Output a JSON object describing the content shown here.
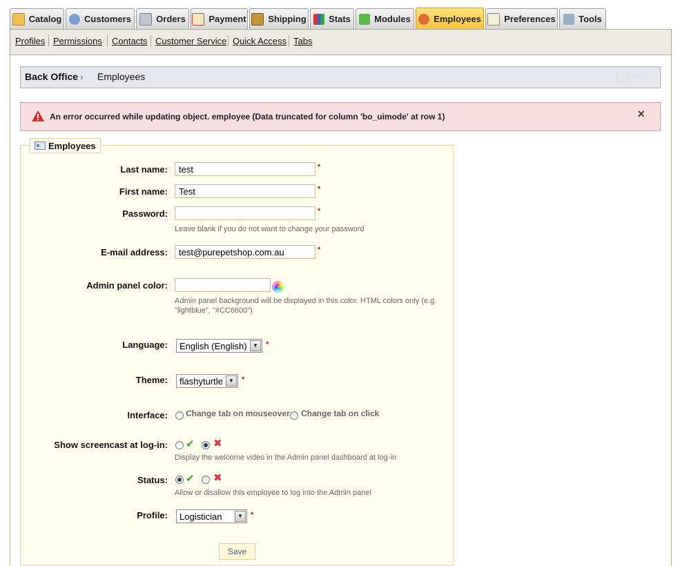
{
  "tabs": [
    {
      "label": "Catalog",
      "icon": "folder-icon",
      "active": false
    },
    {
      "label": "Customers",
      "icon": "user-icon",
      "active": false
    },
    {
      "label": "Orders",
      "icon": "cart-icon",
      "active": false
    },
    {
      "label": "Payment",
      "icon": "invoice-icon",
      "active": false
    },
    {
      "label": "Shipping",
      "icon": "truck-icon",
      "active": false
    },
    {
      "label": "Stats",
      "icon": "bar-chart-icon",
      "active": false
    },
    {
      "label": "Modules",
      "icon": "puzzle-icon",
      "active": false
    },
    {
      "label": "Employees",
      "icon": "employee-icon",
      "active": true
    },
    {
      "label": "Preferences",
      "icon": "preferences-icon",
      "active": false
    },
    {
      "label": "Tools",
      "icon": "wrench-icon",
      "active": false
    }
  ],
  "submenu": [
    "Profiles",
    "Permissions",
    "Contacts",
    "Customer Service",
    "Quick Access",
    "Tabs"
  ],
  "breadcrumb": {
    "root": "Back Office",
    "separator": "›",
    "current": "Employees",
    "help": "HELP"
  },
  "error": {
    "message": "An error occurred while updating object. employee (Data truncated for column 'bo_uimode' at row 1)",
    "close": "×"
  },
  "form": {
    "legend": "Employees",
    "last_name": {
      "label": "Last name:",
      "value": "test"
    },
    "first_name": {
      "label": "First name:",
      "value": "Test"
    },
    "password": {
      "label": "Password:",
      "value": "",
      "hint": "Leave blank if you do not want to change your password"
    },
    "email": {
      "label": "E-mail address:",
      "value": "test@purepetshop.com.au"
    },
    "admin_color": {
      "label": "Admin panel color:",
      "value": "",
      "hint_line1": "Admin panel background will be displayed in this color. HTML colors only (e.g.",
      "hint_line2": "\"lightblue\", \"#CC6600\")"
    },
    "language": {
      "label": "Language:",
      "value": "English (English)"
    },
    "theme": {
      "label": "Theme:",
      "value": "flashyturtle"
    },
    "interface": {
      "label": "Interface:",
      "option1": "Change tab on mouseover",
      "option2": "Change tab on click"
    },
    "screencast": {
      "label": "Show screencast at log-in:",
      "hint": "Display the welcome video in the Admin panel dashboard at log-in",
      "enabled": false
    },
    "status": {
      "label": "Status:",
      "hint": "Allow or disallow this employee to log into the Admin panel",
      "enabled": true
    },
    "profile": {
      "label": "Profile:",
      "value": "Logistician"
    },
    "required_mark": "*",
    "save_label": "Save"
  },
  "colors": {
    "active_tab": "#f7c23a",
    "error_bg": "#f7dfe0",
    "fieldset_bg": "#fffff0",
    "breadcrumb_bg": "#e4e9ed"
  }
}
